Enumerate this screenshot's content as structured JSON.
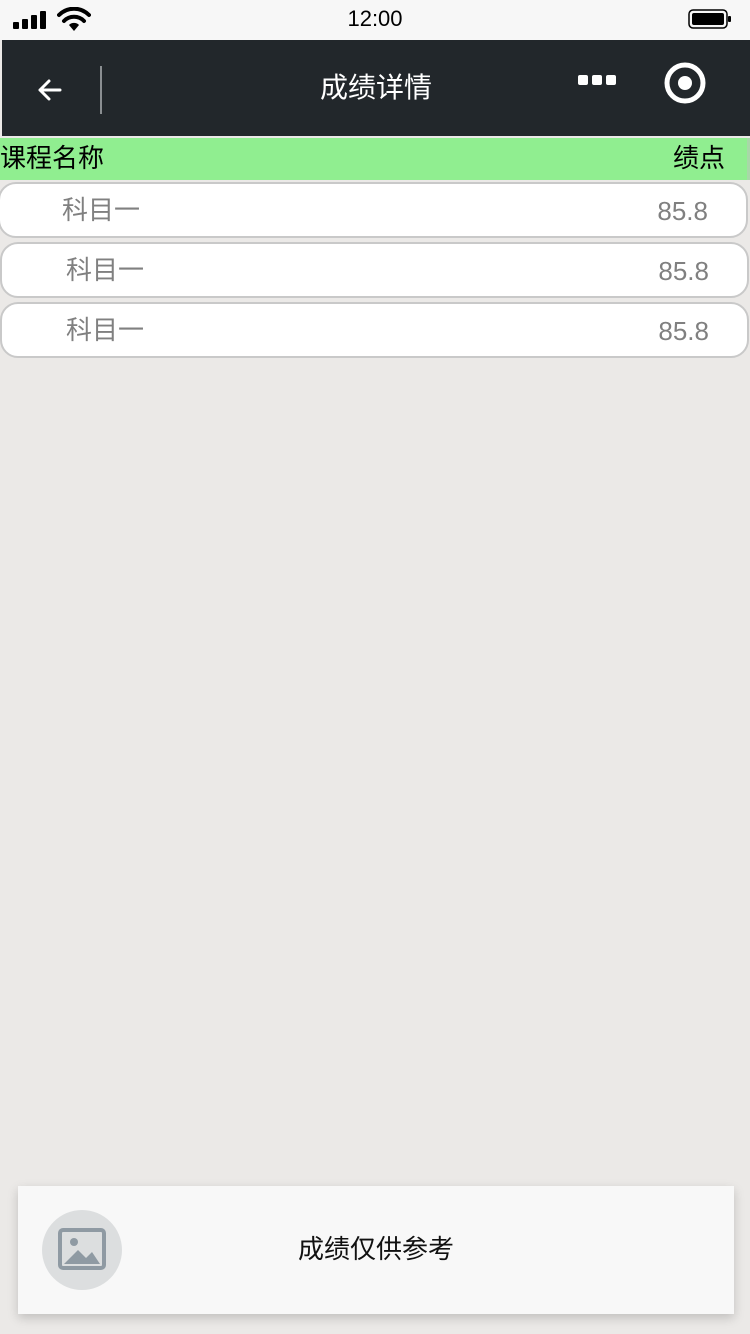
{
  "status_bar": {
    "time": "12:00"
  },
  "nav": {
    "title": "成绩详情",
    "back_icon": "arrow-left-icon",
    "more_icon": "more-dots-icon",
    "target_icon": "record-target-icon"
  },
  "table": {
    "headers": {
      "name": "课程名称",
      "score": "绩点"
    },
    "rows": [
      {
        "name": "科目一",
        "score": "85.8"
      },
      {
        "name": "科目一",
        "score": "85.8"
      },
      {
        "name": "科目一",
        "score": "85.8"
      }
    ]
  },
  "toast": {
    "icon": "image-icon",
    "message": "成绩仅供参考"
  },
  "colors": {
    "nav_bg": "#22272b",
    "header_bg": "#90ee90",
    "page_bg": "#ebe9e7",
    "row_text": "#808080"
  }
}
